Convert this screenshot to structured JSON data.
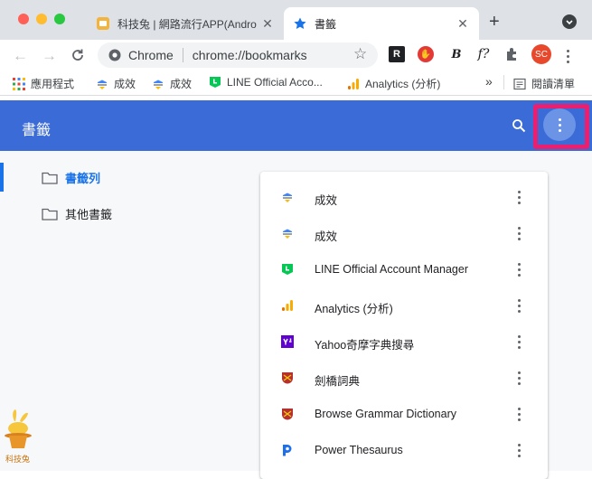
{
  "tabs": [
    {
      "title": "科技兔 | 網路流行APP(Andro",
      "active": false
    },
    {
      "title": "書籤",
      "active": true
    }
  ],
  "toolbar": {
    "site_label": "Chrome",
    "url": "chrome://bookmarks",
    "profile_initials": "SC"
  },
  "bookmarks_bar": {
    "apps_label": "應用程式",
    "items": [
      "成效",
      "成效",
      "LINE Official Acco...",
      "Analytics (分析)"
    ],
    "overflow": "»",
    "reading_list": "閱讀清單"
  },
  "app": {
    "title": "書籤",
    "folders": [
      {
        "label": "書籤列",
        "selected": true
      },
      {
        "label": "其他書籤",
        "selected": false
      }
    ],
    "bookmarks": [
      {
        "label": "成效",
        "icon": "ads-icon"
      },
      {
        "label": "成效",
        "icon": "ads-icon"
      },
      {
        "label": "LINE Official Account Manager",
        "icon": "line-icon"
      },
      {
        "label": "Analytics (分析)",
        "icon": "analytics-icon"
      },
      {
        "label": "Yahoo奇摩字典搜尋",
        "icon": "yahoo-icon"
      },
      {
        "label": "劍橋詞典",
        "icon": "cambridge-icon"
      },
      {
        "label": "Browse Grammar Dictionary",
        "icon": "cambridge-icon"
      },
      {
        "label": "Power Thesaurus",
        "icon": "power-thesaurus-icon"
      }
    ]
  },
  "watermark": {
    "label": "科技兔"
  },
  "colors": {
    "header": "#3b6bd6",
    "highlight": "#ea1f6f",
    "selected": "#1a73e8"
  }
}
